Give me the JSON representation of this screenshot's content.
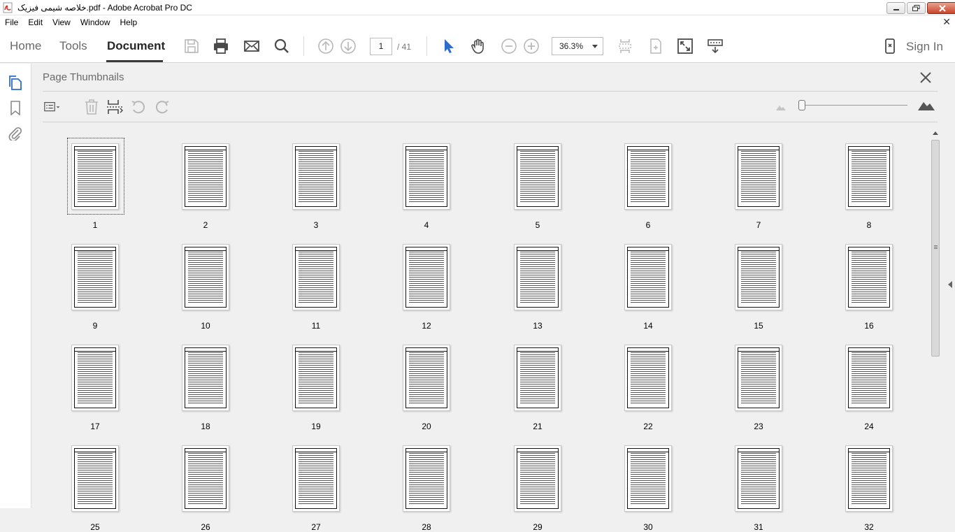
{
  "window": {
    "title": "خلاصه شیمی فیزیک.pdf - Adobe Acrobat Pro DC",
    "icon": "acrobat-pdf-icon"
  },
  "menu": [
    "File",
    "Edit",
    "View",
    "Window",
    "Help"
  ],
  "toolbar": {
    "tabs": [
      "Home",
      "Tools",
      "Document"
    ],
    "active_tab": "Document",
    "page_current": "1",
    "page_total": "/ 41",
    "zoom": "36.3%",
    "sign_in": "Sign In",
    "icons": [
      "save-icon",
      "print-icon",
      "email-icon",
      "search-icon",
      "page-up-icon",
      "page-down-icon",
      "select-cursor-icon",
      "hand-tool-icon",
      "zoom-out-icon",
      "zoom-in-icon",
      "fit-page-icon",
      "rotate-page-icon",
      "fullscreen-icon",
      "scroll-mode-icon",
      "mobile-link-icon"
    ]
  },
  "left_rail": [
    "page-thumbnails-icon",
    "bookmark-icon",
    "attachment-icon"
  ],
  "panel": {
    "title": "Page Thumbnails",
    "tools": [
      "options-menu-icon",
      "delete-page-icon",
      "insert-page-icon",
      "rotate-ccw-icon",
      "rotate-cw-icon"
    ]
  },
  "thumbnails": [
    "1",
    "2",
    "3",
    "4",
    "5",
    "6",
    "7",
    "8",
    "9",
    "10",
    "11",
    "12",
    "13",
    "14",
    "15",
    "16",
    "17",
    "18",
    "19",
    "20",
    "21",
    "22",
    "23",
    "24",
    "25",
    "26",
    "27",
    "28",
    "29",
    "30",
    "31",
    "32"
  ],
  "selected_page": "1",
  "colors": {
    "accent": "#2d6ccd",
    "text_dark": "#262626",
    "panel_bg": "#f0f0f0"
  }
}
